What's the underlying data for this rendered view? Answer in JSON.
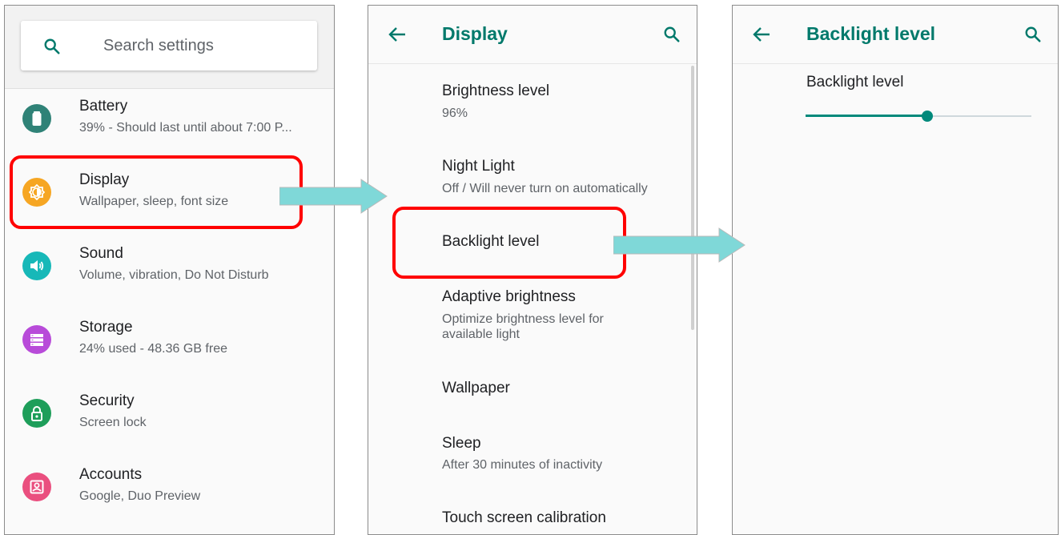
{
  "settings": {
    "search_placeholder": "Search settings",
    "items": [
      {
        "title": "Battery",
        "subtitle": "39% - Should last until about 7:00 P...",
        "icon": "battery-icon",
        "color": "#2f8277"
      },
      {
        "title": "Display",
        "subtitle": "Wallpaper, sleep, font size",
        "icon": "brightness-icon",
        "color": "#f6a623"
      },
      {
        "title": "Sound",
        "subtitle": "Volume, vibration, Do Not Disturb",
        "icon": "volume-icon",
        "color": "#17b8b8"
      },
      {
        "title": "Storage",
        "subtitle": "24% used - 48.36 GB free",
        "icon": "storage-icon",
        "color": "#b84bd9"
      },
      {
        "title": "Security",
        "subtitle": "Screen lock",
        "icon": "lock-icon",
        "color": "#1e9e5a"
      },
      {
        "title": "Accounts",
        "subtitle": "Google, Duo Preview",
        "icon": "account-icon",
        "color": "#ea4f7f"
      }
    ]
  },
  "display": {
    "title": "Display",
    "items": [
      {
        "title": "Brightness level",
        "subtitle": "96%"
      },
      {
        "title": "Night Light",
        "subtitle": "Off / Will never turn on automatically"
      },
      {
        "title": "Backlight level",
        "subtitle": ""
      },
      {
        "title": "Adaptive brightness",
        "subtitle": "Optimize brightness level for available light"
      },
      {
        "title": "Wallpaper",
        "subtitle": ""
      },
      {
        "title": "Sleep",
        "subtitle": "After 30 minutes of inactivity"
      },
      {
        "title": "Touch screen calibration",
        "subtitle": ""
      }
    ]
  },
  "backlight": {
    "title": "Backlight level",
    "slider_label": "Backlight level",
    "slider_value": 0.54
  },
  "colors": {
    "accent": "#00796b",
    "highlight": "#ff0000",
    "arrow": "#7fd8d8"
  }
}
